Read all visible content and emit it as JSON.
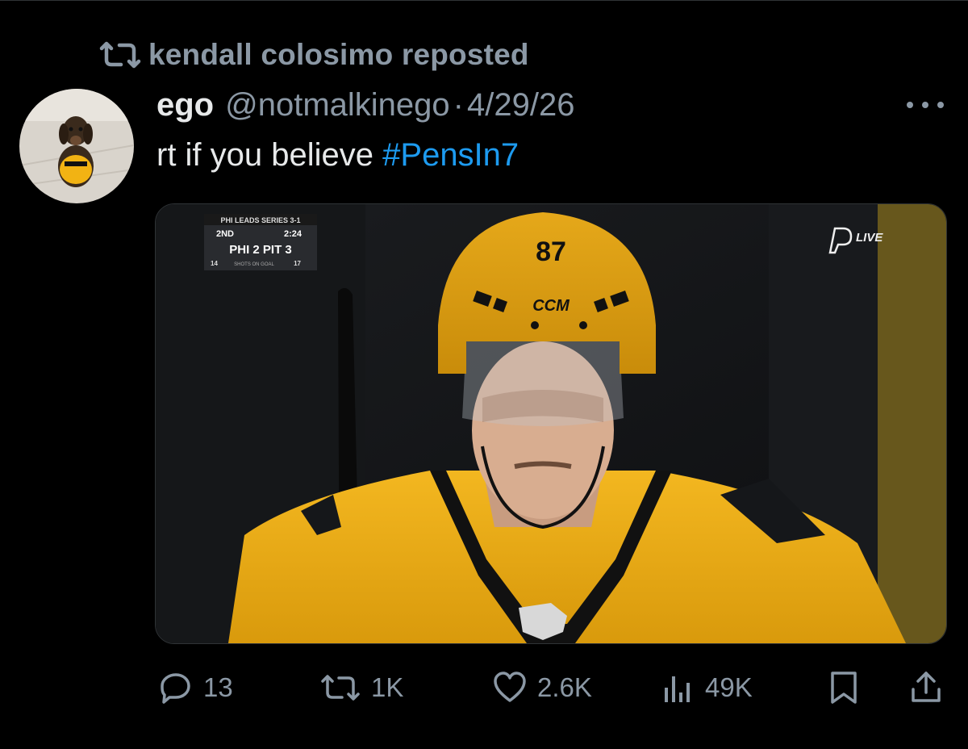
{
  "repost": {
    "text": "kendall colosimo reposted",
    "icon": "repost-icon"
  },
  "tweet": {
    "display_name": "ego",
    "handle": "@notmalkinego",
    "separator": "·",
    "date": "4/29/26",
    "text_prefix": "rt if you believe ",
    "hashtag": "#PensIn7"
  },
  "media": {
    "scorebug": {
      "series": "PHI LEADS SERIES 3-1",
      "period": "2ND",
      "clock": "2:24",
      "score": "PHI 2 PIT 3",
      "shots_left": "14",
      "shots_label": "SHOTS ON GOAL",
      "shots_right": "17"
    },
    "live_badge": "LIVE",
    "helmet_number": "87",
    "helmet_brand": "CCM"
  },
  "actions": {
    "replies": "13",
    "reposts": "1K",
    "likes": "2.6K",
    "views": "49K"
  },
  "colors": {
    "background": "#000000",
    "text": "#e7e9ea",
    "muted": "#8b98a5",
    "link": "#1d9bf0",
    "gold": "#f2b313"
  }
}
